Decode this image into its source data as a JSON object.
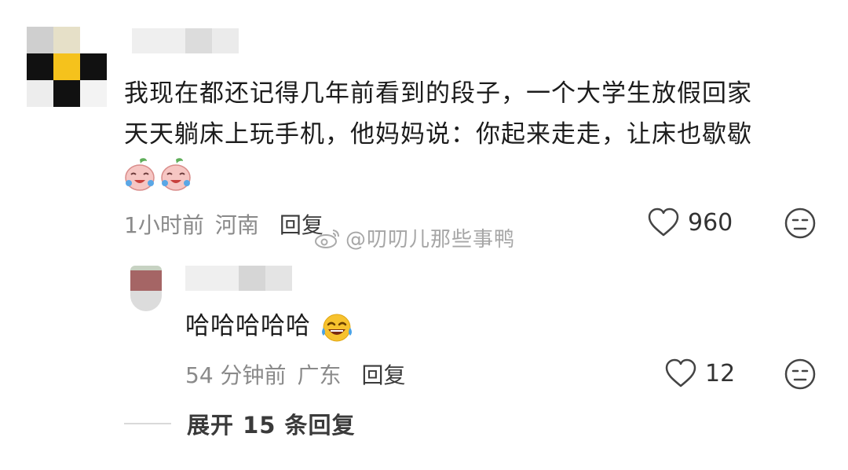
{
  "comment": {
    "text_line1": "我现在都还记得几年前看到的段子，一个大学生放假回家",
    "text_line2": "天天躺床上玩手机，他妈妈说：你起来走走，让床也歇歇",
    "emoji_icons": [
      "crying-laughing-peach-icon",
      "crying-laughing-peach-icon"
    ],
    "time": "1小时前",
    "location": "河南",
    "reply_label": "回复",
    "likes": "960"
  },
  "reply": {
    "text": "哈哈哈哈哈",
    "emoji_icon": "tears-of-joy-icon",
    "time": "54 分钟前",
    "location": "广东",
    "reply_label": "回复",
    "likes": "12"
  },
  "expand": {
    "label": "展开 15 条回复"
  },
  "watermark": {
    "text": "@叨叨儿那些事鸭",
    "icon": "weibo-logo-icon"
  },
  "colors": {
    "avatar_yellow": "#f5c21c",
    "reply_avatar_red": "#a56565",
    "meta_gray": "#8a8a8a"
  }
}
